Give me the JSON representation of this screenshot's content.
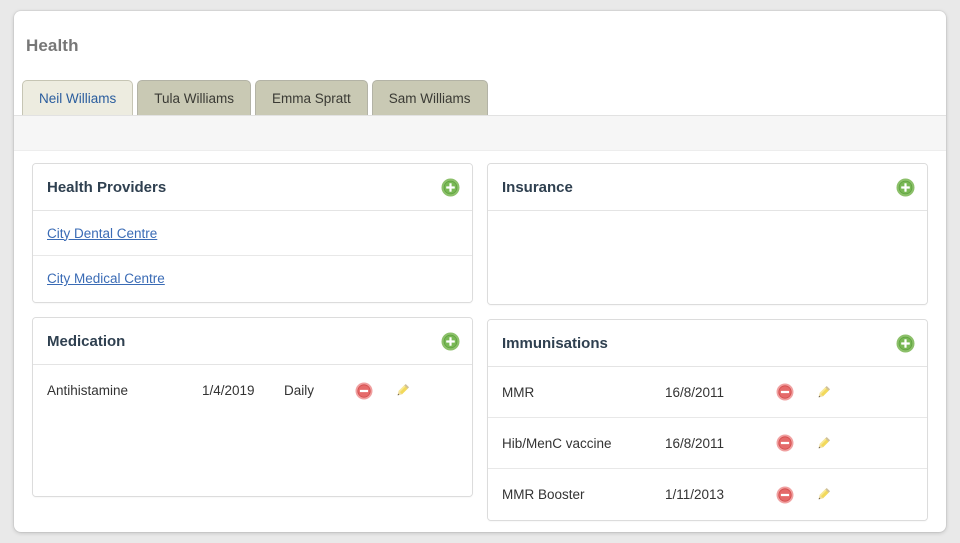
{
  "page": {
    "title": "Health"
  },
  "tabs": [
    {
      "label": "Neil Williams",
      "active": true
    },
    {
      "label": "Tula Williams",
      "active": false
    },
    {
      "label": "Emma Spratt",
      "active": false
    },
    {
      "label": "Sam Williams",
      "active": false
    }
  ],
  "panels": {
    "health_providers": {
      "title": "Health Providers",
      "add_icon": "add-circle-icon",
      "items": [
        {
          "name": "City Dental Centre"
        },
        {
          "name": "City Medical Centre"
        }
      ]
    },
    "insurance": {
      "title": "Insurance",
      "add_icon": "add-circle-icon",
      "items": []
    },
    "medication": {
      "title": "Medication",
      "add_icon": "add-circle-icon",
      "items": [
        {
          "name": "Antihistamine",
          "date": "1/4/2019",
          "frequency": "Daily",
          "delete_icon": "remove-circle-icon",
          "edit_icon": "pencil-icon"
        }
      ]
    },
    "immunisations": {
      "title": "Immunisations",
      "add_icon": "add-circle-icon",
      "items": [
        {
          "name": "MMR",
          "date": "16/8/2011",
          "delete_icon": "remove-circle-icon",
          "edit_icon": "pencil-icon"
        },
        {
          "name": "Hib/MenC vaccine",
          "date": "16/8/2011",
          "delete_icon": "remove-circle-icon",
          "edit_icon": "pencil-icon"
        },
        {
          "name": "MMR Booster",
          "date": "1/11/2013",
          "delete_icon": "remove-circle-icon",
          "edit_icon": "pencil-icon"
        }
      ]
    }
  },
  "colors": {
    "add_green": "#6aab4e",
    "delete_red": "#e05b5b",
    "edit_yellow": "#e8c84a",
    "link_blue": "#3a6bb5",
    "active_tab_text": "#2a5d9e",
    "tab_inactive_bg": "#c9c9b4",
    "tab_active_bg": "#edece0",
    "panel_title": "#2f4050",
    "page_title": "#777777"
  }
}
